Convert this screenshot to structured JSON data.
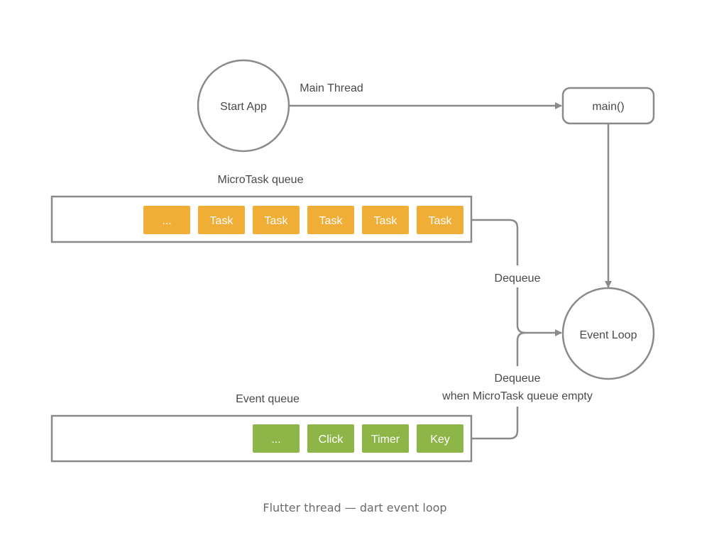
{
  "colors": {
    "line": "#8a8a8a",
    "text": "#4a4a4a",
    "microtask_chip": "#f0ae36",
    "event_chip": "#8db548",
    "chip_text": "#ffffff",
    "caption": "#6b6b6b"
  },
  "nodes": {
    "start_app": "Start App",
    "main": "main()",
    "event_loop": "Event Loop"
  },
  "edges": {
    "main_thread": "Main Thread",
    "dequeue_microtask": "Dequeue",
    "dequeue_event_line1": "Dequeue",
    "dequeue_event_line2": "when MicroTask queue empty"
  },
  "microtask_queue": {
    "title": "MicroTask queue",
    "items": [
      "...",
      "Task",
      "Task",
      "Task",
      "Task",
      "Task"
    ]
  },
  "event_queue": {
    "title": "Event queue",
    "items": [
      "...",
      "Click",
      "Timer",
      "Key"
    ]
  },
  "caption": "Flutter thread — dart event loop"
}
